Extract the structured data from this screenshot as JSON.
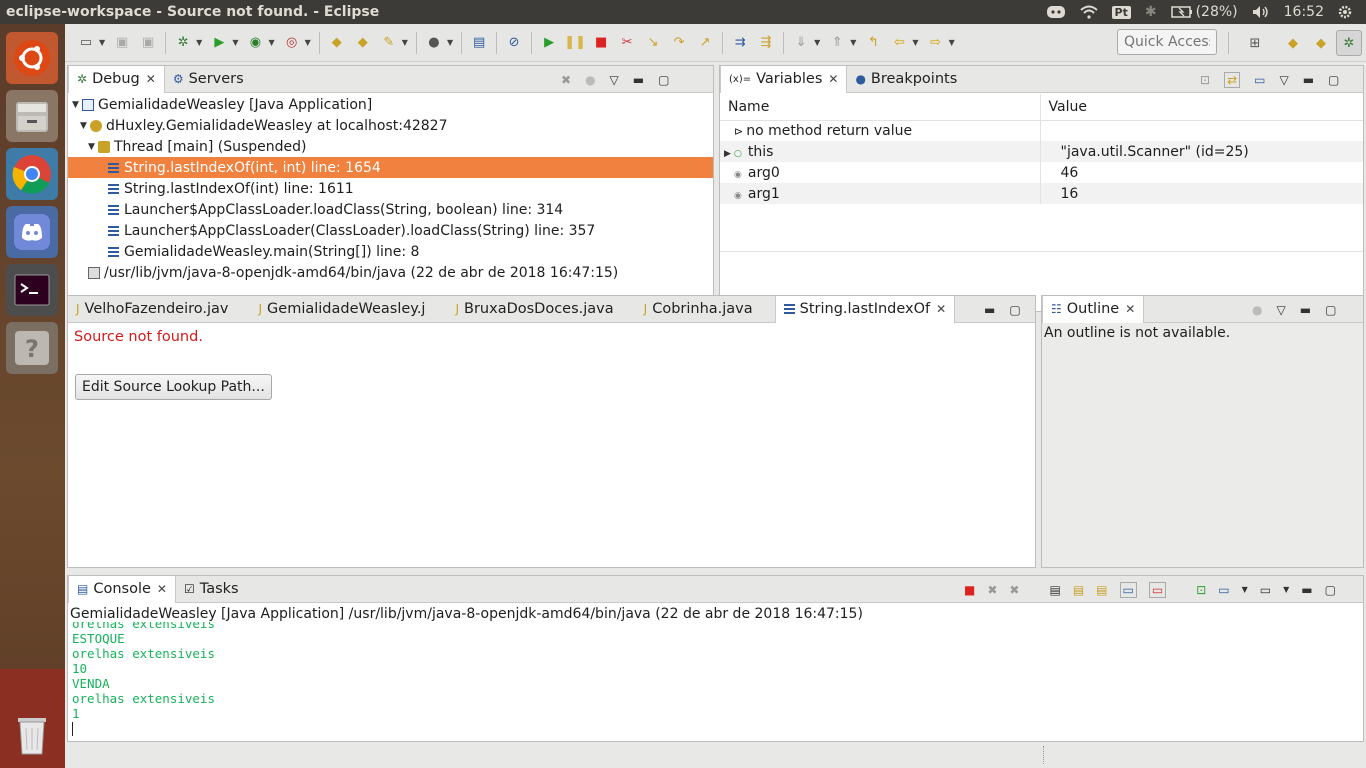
{
  "topbar": {
    "title": "eclipse-workspace - Source not found. - Eclipse",
    "tray_pt": "Pt",
    "battery": "(28%)",
    "clock": "16:52"
  },
  "launcher": {
    "items": [
      {
        "name": "ubuntu-dash-icon"
      },
      {
        "name": "files-icon"
      },
      {
        "name": "chrome-icon"
      },
      {
        "name": "discord-icon"
      },
      {
        "name": "terminal-icon"
      },
      {
        "name": "help-icon"
      },
      {
        "name": "trash-icon"
      }
    ]
  },
  "toolbar": {
    "quick_access": "Quick Access"
  },
  "debug_pane": {
    "tabs": [
      {
        "label": "Debug"
      },
      {
        "label": "Servers"
      }
    ],
    "tree": [
      {
        "text": "GemialidadeWeasley [Java Application]"
      },
      {
        "text": "dHuxley.GemialidadeWeasley at localhost:42827"
      },
      {
        "text": "Thread [main] (Suspended)"
      },
      {
        "text": "String.lastIndexOf(int, int) line: 1654"
      },
      {
        "text": "String.lastIndexOf(int) line: 1611"
      },
      {
        "text": "Launcher$AppClassLoader.loadClass(String, boolean) line: 314"
      },
      {
        "text": "Launcher$AppClassLoader(ClassLoader).loadClass(String) line: 357"
      },
      {
        "text": "GemialidadeWeasley.main(String[]) line: 8"
      },
      {
        "text": "/usr/lib/jvm/java-8-openjdk-amd64/bin/java (22 de abr de 2018 16:47:15)"
      }
    ]
  },
  "variables_pane": {
    "tabs": [
      {
        "label": "Variables"
      },
      {
        "label": "Breakpoints"
      }
    ],
    "columns": {
      "name": "Name",
      "value": "Value"
    },
    "rows": [
      {
        "name": "no method return value",
        "value": ""
      },
      {
        "name": "this",
        "value": "\"java.util.Scanner\" (id=25)"
      },
      {
        "name": "arg0",
        "value": "46"
      },
      {
        "name": "arg1",
        "value": "16"
      }
    ]
  },
  "editor": {
    "tabs": [
      {
        "label": "VelhoFazendeiro.jav"
      },
      {
        "label": "GemialidadeWeasley.j"
      },
      {
        "label": "BruxaDosDoces.java"
      },
      {
        "label": "Cobrinha.java"
      },
      {
        "label": "String.lastIndexOf"
      }
    ],
    "message": "Source not found.",
    "button": "Edit Source Lookup Path..."
  },
  "outline": {
    "tab": "Outline",
    "message": "An outline is not available."
  },
  "console": {
    "tabs": [
      {
        "label": "Console"
      },
      {
        "label": "Tasks"
      }
    ],
    "header": "GemialidadeWeasley [Java Application] /usr/lib/jvm/java-8-openjdk-amd64/bin/java (22 de abr de 2018 16:47:15)",
    "lines": [
      "orelhas extensiveis",
      "ESTOQUE",
      "orelhas extensiveis",
      "10",
      "VENDA",
      "orelhas extensiveis",
      "1"
    ]
  }
}
